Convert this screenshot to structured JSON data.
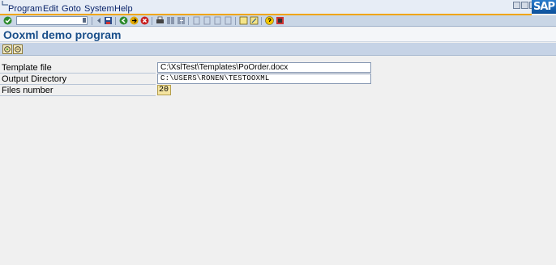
{
  "menu": {
    "items": [
      "Program",
      "Edit",
      "Goto",
      "System",
      "Help"
    ]
  },
  "logo": {
    "text": "SAP"
  },
  "toolbar": {
    "command_field_value": "",
    "icons": [
      "enter-icon",
      "back-icon",
      "save-icon",
      "back-nav-icon",
      "exit-icon",
      "cancel-icon",
      "print-icon",
      "find-icon",
      "find-next-icon",
      "first-page-icon",
      "prev-page-icon",
      "next-page-icon",
      "last-page-icon",
      "create-session-icon",
      "shortcut-icon",
      "help-icon",
      "layout-icon"
    ]
  },
  "page": {
    "title": "Ooxml demo program"
  },
  "app_toolbar": {
    "icons": [
      "execute-icon",
      "variant-icon"
    ]
  },
  "form": {
    "template_file": {
      "label": "Template file",
      "value": "C:\\XslTest\\Templates\\PoOrder.docx"
    },
    "output_directory": {
      "label": "Output Directory",
      "value": "C:\\USERS\\RONEN\\TESTOOXML"
    },
    "files_number": {
      "label": "Files number",
      "value": "20"
    }
  },
  "colors": {
    "menu_bg": "#e7edf6",
    "accent": "#f0a500",
    "title_text": "#1a4f8a",
    "app_toolbar_bg": "#c6d3e6",
    "number_field_bg": "#f5e4a0"
  }
}
